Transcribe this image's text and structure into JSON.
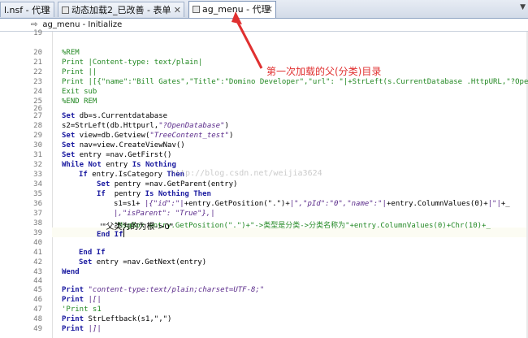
{
  "tabs": [
    {
      "label": "l.nsf - 代理",
      "active": false
    },
    {
      "label": "动态加载2_已改善 - 表单",
      "active": false
    },
    {
      "label": "ag_menu - 代理",
      "active": true
    }
  ],
  "tabbar_overflow": "▼",
  "subheader": {
    "arrow": "⇨",
    "title": "ag_menu - Initialize"
  },
  "line_numbers": [
    "19",
    "20",
    "21",
    "22",
    "23",
    "24",
    "25",
    "26",
    "27",
    "28",
    "29",
    "30",
    "31",
    "32",
    "33",
    "34",
    "35",
    "36",
    "37",
    "38",
    "39",
    "40",
    "41",
    "42",
    "43",
    "44",
    "45",
    "46",
    "47",
    "48",
    "49"
  ],
  "code": {
    "l19": "",
    "l20": "%REM",
    "l21": "Print |Content-type: text/plain|",
    "l22": "Print ||",
    "l23": "Print |[{\"name\":\"Bill Gates\",\"Title\":\"Domino Developer\",\"url\": \"|+StrLeft(s.CurrentDatabase .HttpURL,\"?OpenDa",
    "l24": "Exit sub",
    "l25": "%END REM",
    "l27_a": "Set ",
    "l27_b": "db=s.Currentdatabase",
    "l28_a": "s2=StrLeft(db.Httpurl,",
    "l28_b": "\"?OpenDatabase\"",
    "l28_c": ")",
    "l29_a": "Set ",
    "l29_b": "view=db.Getview(",
    "l29_c": "\"TreeContent_test\"",
    "l29_d": ")",
    "l30_a": "Set ",
    "l30_b": "nav=view.CreateViewNav()",
    "l31_a": "Set ",
    "l31_b": "entry =nav.GetFirst()",
    "l32_a": "While Not ",
    "l32_b": "entry ",
    "l32_c": "Is Nothing",
    "l33_a": "If ",
    "l33_b": "entry.IsCategory ",
    "l33_c": "Then",
    "l34_a": "Set ",
    "l34_b": "pentry =nav.GetParent(entry)",
    "l35_a": "If  ",
    "l35_b": "pentry ",
    "l35_c": "Is Nothing Then",
    "l36_a": "s1=s1+ ",
    "l36_b": "|{\"id\":\"|",
    "l36_c": "+entry.GetPosition(\".\")+",
    "l36_d": "|\",\"pId\":\"0\",\"name\":\"|",
    "l36_e": "+entry.ColumnValues(0)+",
    "l36_f": "|\"|",
    "l36_g": "+_",
    "l37_a": "|,\"isParent\": \"True\"},|",
    "l38_a": "'MsgBox entry.GetPosition(\".\")+\"->类型是分类->分类名称为\"+entry.ColumnValues(0)+Chr(10)+_",
    "l39_a": "End If",
    "l41_a": "End If",
    "l42_a": "Set ",
    "l42_b": "entry =nav.GetNext(entry)",
    "l43_a": "Wend",
    "l45_a": "Print ",
    "l45_b": "\"content-type:text/plain;charset=UTF-8;\"",
    "l46_a": "Print ",
    "l46_b": "|[|",
    "l47_a": "'Print s1",
    "l48_a": "Print ",
    "l48_b": "StrLeftback(s1,\",\")",
    "l49_a": "Print ",
    "l49_b": "|]|"
  },
  "annotations": {
    "note1": "第一次加载的父(分类)目录",
    "note2": "+entry.ColumnValues(0)+Chr(10)+_",
    "note3": "'\"父类为的为根->0\""
  },
  "watermark": "http://blog.csdn.net/weijia3624",
  "colors": {
    "comment": "#228822",
    "keyword": "#1a1aa0",
    "string": "#5a2a8a",
    "annotation": "#e03030"
  }
}
